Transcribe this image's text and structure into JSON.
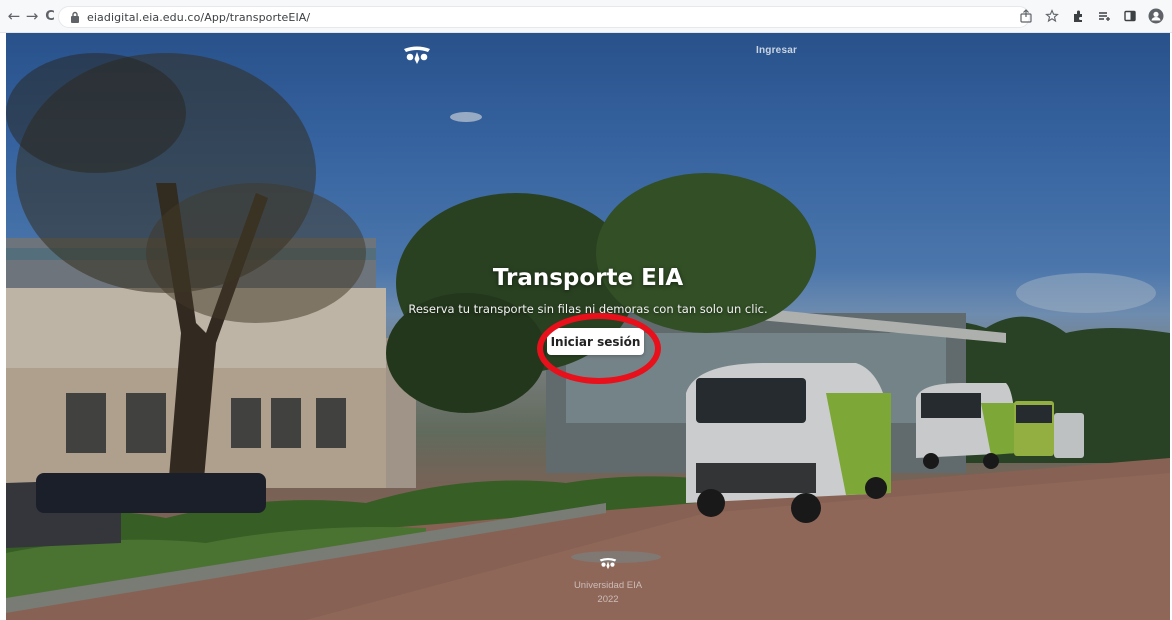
{
  "browser": {
    "url": "eiadigital.eia.edu.co/App/transporteEIA/",
    "back_glyph": "←",
    "forward_glyph": "→",
    "reload_glyph": "C",
    "toolbar_icons": [
      "share-icon",
      "bookmark-star-icon",
      "extensions-icon",
      "reading-list-icon",
      "side-panel-icon",
      "profile-icon"
    ]
  },
  "header": {
    "login_label": "Ingresar"
  },
  "hero": {
    "title": "Transporte EIA",
    "subtitle": "Reserva tu transporte sin filas ni demoras con tan solo un clic.",
    "cta_label": "Iniciar sesión",
    "highlight_color": "#e8101a"
  },
  "footer": {
    "org": "Universidad EIA",
    "year": "2022"
  }
}
